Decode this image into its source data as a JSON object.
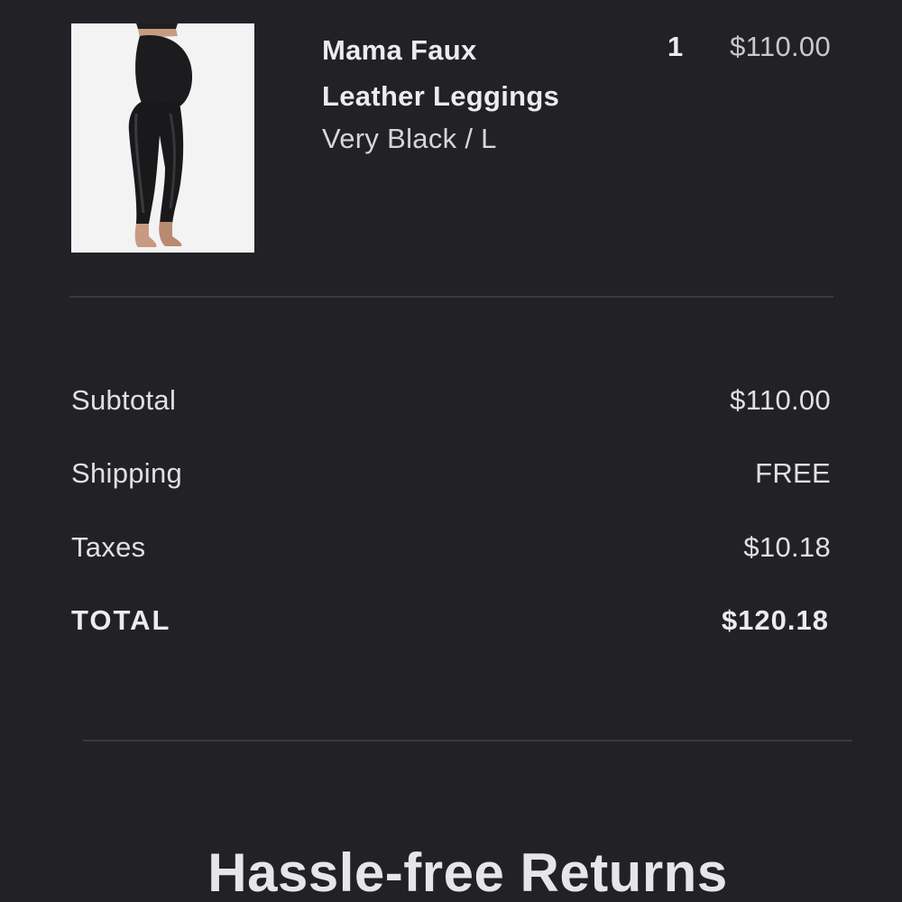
{
  "line_item": {
    "image_alt": "Mama Faux Leather Leggings",
    "name_line1": "Mama Faux",
    "name_line2": "Leather Leggings",
    "variant": "Very Black / L",
    "quantity": "1",
    "price": "$110.00"
  },
  "summary": {
    "subtotal_label": "Subtotal",
    "subtotal_value": "$110.00",
    "shipping_label": "Shipping",
    "shipping_value": "FREE",
    "taxes_label": "Taxes",
    "taxes_value": "$10.18",
    "total_label": "TOTAL",
    "total_value": "$120.18"
  },
  "returns": {
    "heading": "Hassle-free Returns"
  },
  "colors": {
    "background": "#222226",
    "divider": "#3a3a40",
    "text": "#e6e6e8"
  }
}
